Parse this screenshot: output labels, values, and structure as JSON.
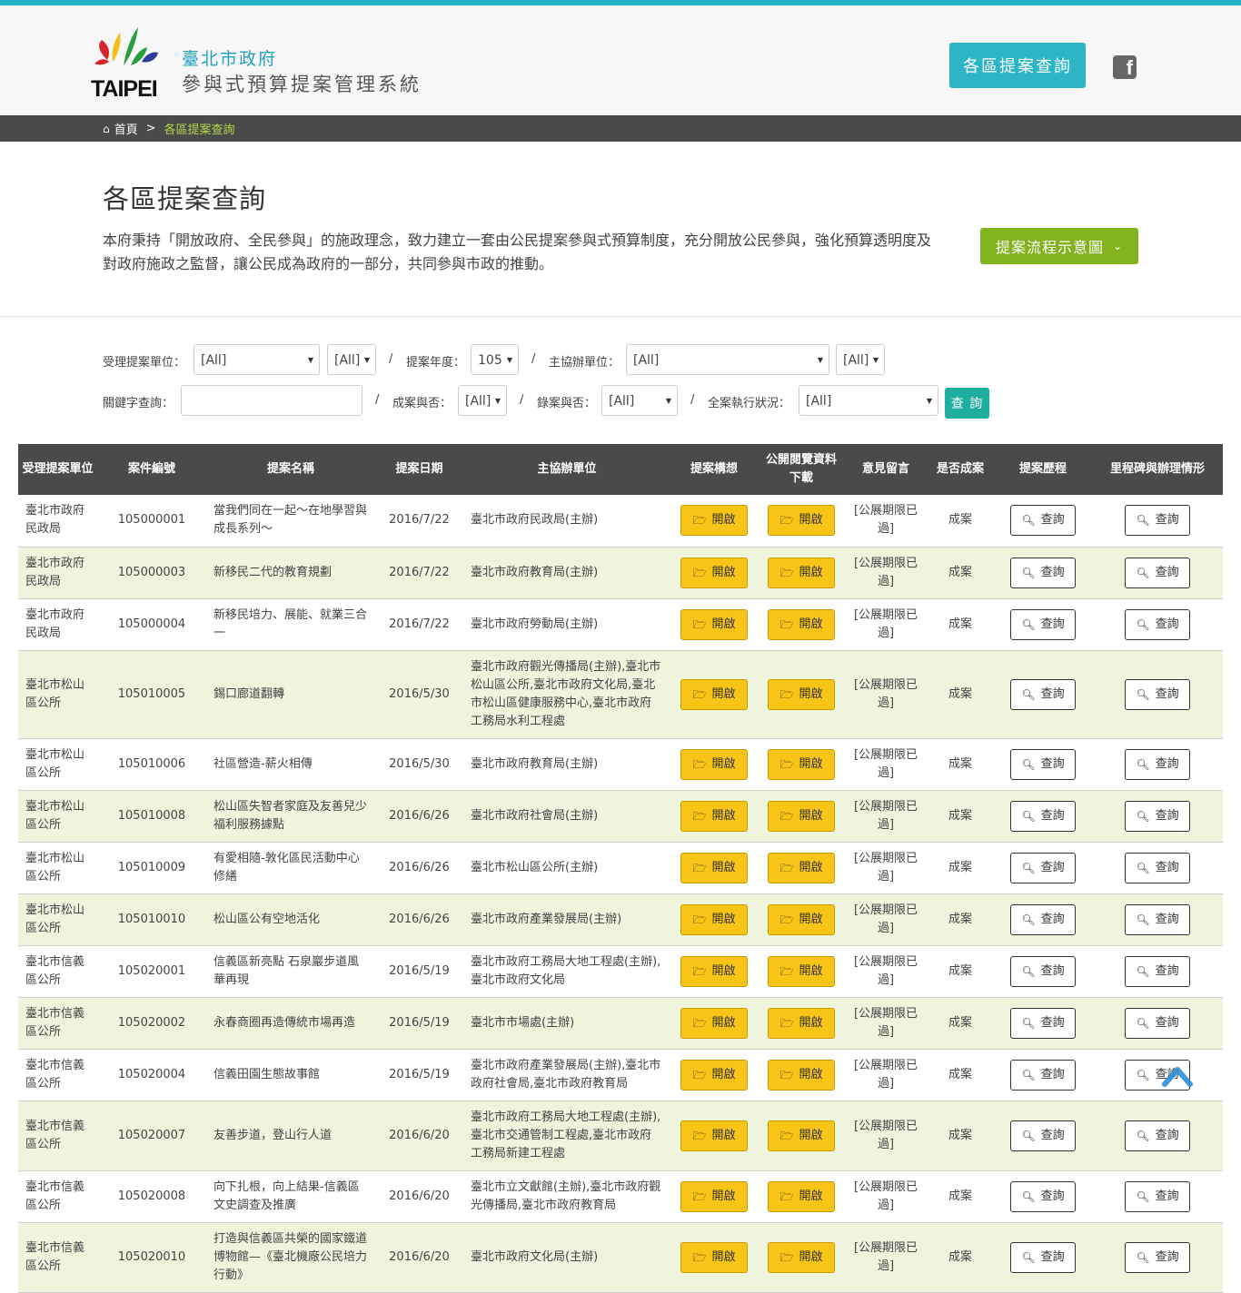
{
  "header": {
    "logo_text": "TAIPEI",
    "org_name": "臺北市政府",
    "system_name": "參與式預算提案管理系統",
    "nav_button": "各區提案查詢",
    "facebook_glyph": "f"
  },
  "breadcrumb": {
    "home": "首頁",
    "separator": ">",
    "current": "各區提案查詢"
  },
  "page": {
    "title": "各區提案查詢",
    "intro": "本府秉持「開放政府、全民參與」的施政理念，致力建立一套由公民提案參與式預算制度，充分開放公民參與，強化預算透明度及對政府施政之監督，讓公民成為政府的一部分，共同參與市政的推動。",
    "flow_button": "提案流程示意圖"
  },
  "filters": {
    "unit_label": "受理提案單位：",
    "unit_value": "[All]",
    "unit_sub_value": "[All]",
    "sep": "/",
    "year_label": "提案年度：",
    "year_value": "105",
    "host_label": "主協辦單位：",
    "host_value": "[All]",
    "host_sub_value": "[All]",
    "keyword_label": "關鍵字查詢：",
    "keyword_value": "",
    "case_label": "成案與否：",
    "case_value": "[All]",
    "record_label": "錄案與否：",
    "record_value": "[All]",
    "status_label": "全案執行狀況：",
    "status_value": "[All]",
    "search_button": "查 詢"
  },
  "table": {
    "headers": [
      "受理提案單位",
      "案件編號",
      "提案名稱",
      "提案日期",
      "主協辦單位",
      "提案構想",
      "公開閱覽資料下載",
      "意見留言",
      "是否成案",
      "提案歷程",
      "里程碑與辦理情形"
    ],
    "open_label": "開啟",
    "query_label": "查詢",
    "rows": [
      {
        "unit": "臺北市政府民政局",
        "id": "105000001",
        "name": "當我們同在一起～在地學習與成長系列～",
        "date": "2016/7/22",
        "host": "臺北市政府民政局(主辦)",
        "comment": "[公展期限已過]",
        "status": "成案"
      },
      {
        "unit": "臺北市政府民政局",
        "id": "105000003",
        "name": "新移民二代的教育規劃",
        "date": "2016/7/22",
        "host": "臺北市政府教育局(主辦)",
        "comment": "[公展期限已過]",
        "status": "成案"
      },
      {
        "unit": "臺北市政府民政局",
        "id": "105000004",
        "name": "新移民培力、展能、就業三合一",
        "date": "2016/7/22",
        "host": "臺北市政府勞動局(主辦)",
        "comment": "[公展期限已過]",
        "status": "成案"
      },
      {
        "unit": "臺北市松山區公所",
        "id": "105010005",
        "name": "錫口廊道翻轉",
        "date": "2016/5/30",
        "host": "臺北市政府觀光傳播局(主辦),臺北市松山區公所,臺北市政府文化局,臺北市松山區健康服務中心,臺北市政府工務局水利工程處",
        "comment": "[公展期限已過]",
        "status": "成案"
      },
      {
        "unit": "臺北市松山區公所",
        "id": "105010006",
        "name": "社區營造-薪火相傳",
        "date": "2016/5/30",
        "host": "臺北市政府教育局(主辦)",
        "comment": "[公展期限已過]",
        "status": "成案"
      },
      {
        "unit": "臺北市松山區公所",
        "id": "105010008",
        "name": "松山區失智者家庭及友善兒少福利服務據點",
        "date": "2016/6/26",
        "host": "臺北市政府社會局(主辦)",
        "comment": "[公展期限已過]",
        "status": "成案"
      },
      {
        "unit": "臺北市松山區公所",
        "id": "105010009",
        "name": "有愛相隨-敦化區民活動中心修繕",
        "date": "2016/6/26",
        "host": "臺北市松山區公所(主辦)",
        "comment": "[公展期限已過]",
        "status": "成案"
      },
      {
        "unit": "臺北市松山區公所",
        "id": "105010010",
        "name": "松山區公有空地活化",
        "date": "2016/6/26",
        "host": "臺北市政府產業發展局(主辦)",
        "comment": "[公展期限已過]",
        "status": "成案"
      },
      {
        "unit": "臺北市信義區公所",
        "id": "105020001",
        "name": "信義區新亮點 石泉巖步道風華再現",
        "date": "2016/5/19",
        "host": "臺北市政府工務局大地工程處(主辦),臺北市政府文化局",
        "comment": "[公展期限已過]",
        "status": "成案"
      },
      {
        "unit": "臺北市信義區公所",
        "id": "105020002",
        "name": "永春商圈再造傳統市場再造",
        "date": "2016/5/19",
        "host": "臺北市市場處(主辦)",
        "comment": "[公展期限已過]",
        "status": "成案"
      },
      {
        "unit": "臺北市信義區公所",
        "id": "105020004",
        "name": "信義田園生態故事館",
        "date": "2016/5/19",
        "host": "臺北市政府產業發展局(主辦),臺北市政府社會局,臺北市政府教育局",
        "comment": "[公展期限已過]",
        "status": "成案"
      },
      {
        "unit": "臺北市信義區公所",
        "id": "105020007",
        "name": "友善步道，登山行人道",
        "date": "2016/6/20",
        "host": "臺北市政府工務局大地工程處(主辦),臺北市交通管制工程處,臺北市政府工務局新建工程處",
        "comment": "[公展期限已過]",
        "status": "成案"
      },
      {
        "unit": "臺北市信義區公所",
        "id": "105020008",
        "name": "向下扎根，向上結果-信義區文史調查及推廣",
        "date": "2016/6/20",
        "host": "臺北市立文獻館(主辦),臺北市政府觀光傳播局,臺北市政府教育局",
        "comment": "[公展期限已過]",
        "status": "成案"
      },
      {
        "unit": "臺北市信義區公所",
        "id": "105020010",
        "name": "打造與信義區共榮的國家鐵道博物館—《臺北機廠公民培力行動》",
        "date": "2016/6/20",
        "host": "臺北市政府文化局(主辦)",
        "comment": "[公展期限已過]",
        "status": "成案"
      }
    ]
  }
}
